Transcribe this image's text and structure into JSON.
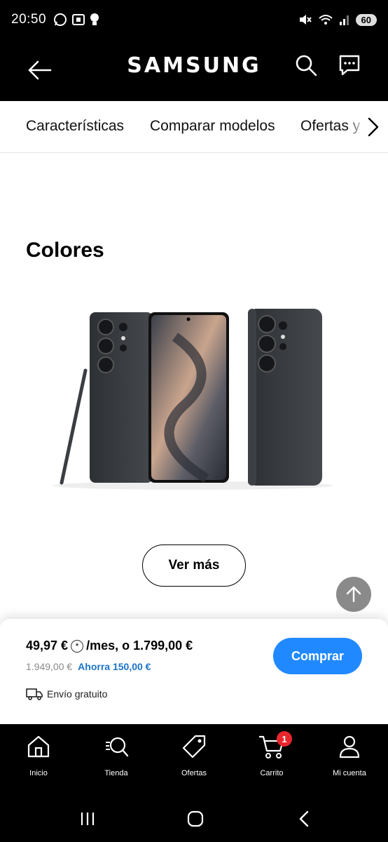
{
  "status_bar": {
    "time": "20:50",
    "battery": "60"
  },
  "header": {
    "logo": "SAMSUNG"
  },
  "subnav": {
    "tabs": [
      "Características",
      "Comparar modelos",
      "Ofertas y D"
    ]
  },
  "section": {
    "title": "Colores"
  },
  "ver_mas": "Ver más",
  "price": {
    "monthly": "49,97 €",
    "info_symbol": "*",
    "monthly_suffix": "/mes, o 1.799,00 €",
    "old_price": "1.949,00 €",
    "savings": "Ahorra 150,00 €",
    "shipping": "Envío gratuito",
    "buy_label": "Comprar"
  },
  "bottom_nav": {
    "items": [
      {
        "label": "Inicio",
        "icon": "home-icon"
      },
      {
        "label": "Tienda",
        "icon": "store-search-icon"
      },
      {
        "label": "Ofertas",
        "icon": "tag-icon"
      },
      {
        "label": "Carrito",
        "icon": "cart-icon",
        "badge": "1"
      },
      {
        "label": "Mi cuenta",
        "icon": "user-icon"
      }
    ]
  },
  "colors": {
    "accent": "#2189ff",
    "badge": "#e8272d",
    "savings": "#1a73c9",
    "scroll_button": "#8a8a8a"
  }
}
